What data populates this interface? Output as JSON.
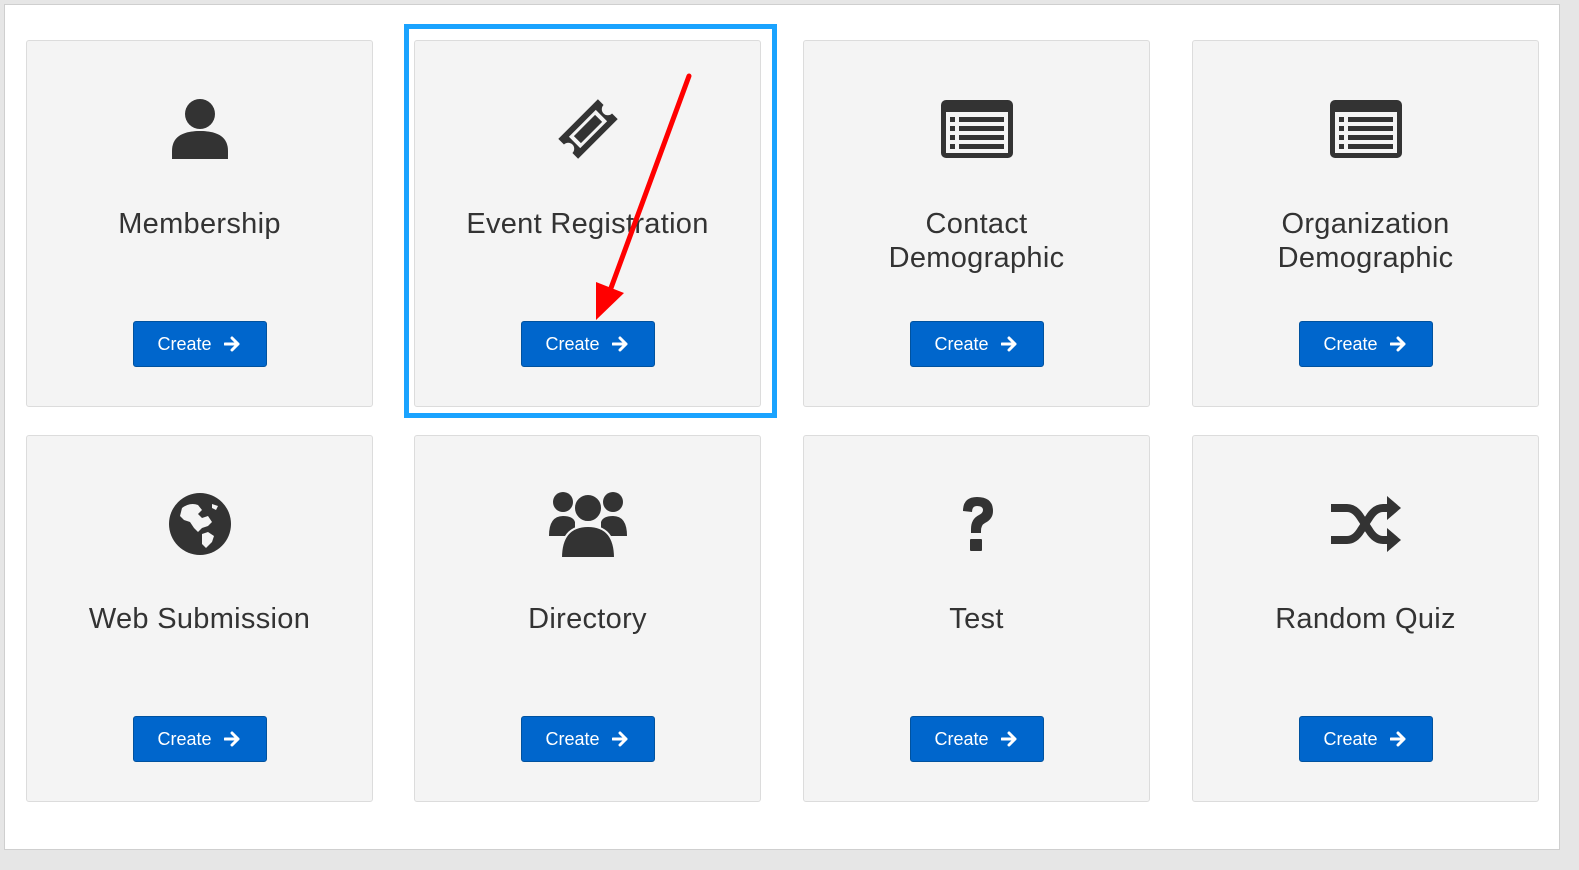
{
  "cards": [
    {
      "id": "membership",
      "title": "Membership",
      "icon": "user-icon",
      "button_label": "Create"
    },
    {
      "id": "event-registration",
      "title": "Event Registration",
      "icon": "ticket-icon",
      "button_label": "Create"
    },
    {
      "id": "contact-demographic",
      "title": "Contact Demographic",
      "icon": "list-icon",
      "button_label": "Create"
    },
    {
      "id": "organization-demographic",
      "title": "Organization Demographic",
      "icon": "list-icon",
      "button_label": "Create"
    },
    {
      "id": "web-submission",
      "title": "Web Submission",
      "icon": "globe-icon",
      "button_label": "Create"
    },
    {
      "id": "directory",
      "title": "Directory",
      "icon": "users-icon",
      "button_label": "Create"
    },
    {
      "id": "test",
      "title": "Test",
      "icon": "question-icon",
      "button_label": "Create"
    },
    {
      "id": "random-quiz",
      "title": "Random Quiz",
      "icon": "shuffle-icon",
      "button_label": "Create"
    }
  ],
  "colors": {
    "button": "#0066cc",
    "highlight": "#1aa3ff",
    "arrow": "#ff0000",
    "icon": "#333333"
  },
  "highlighted_card": "event-registration"
}
